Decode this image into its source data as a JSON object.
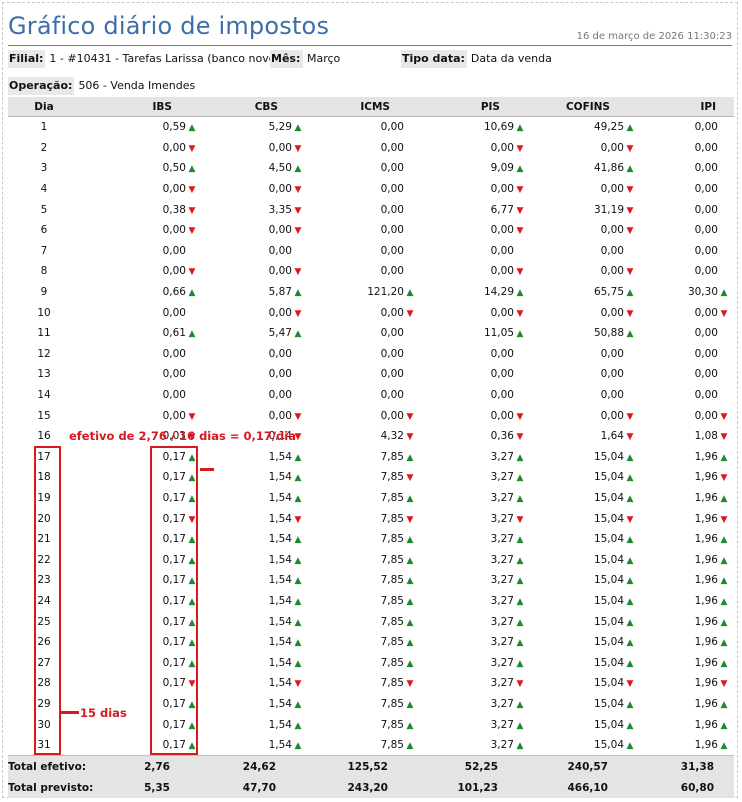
{
  "header": {
    "title": "Gráfico diário de impostos",
    "timestamp": "16 de março de 2026 11:30:23"
  },
  "filters": {
    "filial_label": "Filial:",
    "filial_value": "1 - #10431 - Tarefas Larissa (banco novo)",
    "mes_label": "Mês:",
    "mes_value": "Março",
    "tipo_label": "Tipo data:",
    "tipo_value": "Data da venda",
    "operacao_label": "Operação:",
    "operacao_value": "506 - Venda Imendes"
  },
  "table": {
    "columns": [
      "Dia",
      "IBS",
      "CBS",
      "ICMS",
      "PIS",
      "COFINS",
      "IPI"
    ],
    "rows": [
      [
        "1",
        [
          "0,59",
          "up"
        ],
        [
          "5,29",
          "up"
        ],
        [
          "0,00",
          ""
        ],
        [
          "10,69",
          "up"
        ],
        [
          "49,25",
          "up"
        ],
        [
          "0,00",
          ""
        ]
      ],
      [
        "2",
        [
          "0,00",
          "down"
        ],
        [
          "0,00",
          "down"
        ],
        [
          "0,00",
          ""
        ],
        [
          "0,00",
          "down"
        ],
        [
          "0,00",
          "down"
        ],
        [
          "0,00",
          ""
        ]
      ],
      [
        "3",
        [
          "0,50",
          "up"
        ],
        [
          "4,50",
          "up"
        ],
        [
          "0,00",
          ""
        ],
        [
          "9,09",
          "up"
        ],
        [
          "41,86",
          "up"
        ],
        [
          "0,00",
          ""
        ]
      ],
      [
        "4",
        [
          "0,00",
          "down"
        ],
        [
          "0,00",
          "down"
        ],
        [
          "0,00",
          ""
        ],
        [
          "0,00",
          "down"
        ],
        [
          "0,00",
          "down"
        ],
        [
          "0,00",
          ""
        ]
      ],
      [
        "5",
        [
          "0,38",
          "down"
        ],
        [
          "3,35",
          "down"
        ],
        [
          "0,00",
          ""
        ],
        [
          "6,77",
          "down"
        ],
        [
          "31,19",
          "down"
        ],
        [
          "0,00",
          ""
        ]
      ],
      [
        "6",
        [
          "0,00",
          "down"
        ],
        [
          "0,00",
          "down"
        ],
        [
          "0,00",
          ""
        ],
        [
          "0,00",
          "down"
        ],
        [
          "0,00",
          "down"
        ],
        [
          "0,00",
          ""
        ]
      ],
      [
        "7",
        [
          "0,00",
          ""
        ],
        [
          "0,00",
          ""
        ],
        [
          "0,00",
          ""
        ],
        [
          "0,00",
          ""
        ],
        [
          "0,00",
          ""
        ],
        [
          "0,00",
          ""
        ]
      ],
      [
        "8",
        [
          "0,00",
          "down"
        ],
        [
          "0,00",
          "down"
        ],
        [
          "0,00",
          ""
        ],
        [
          "0,00",
          "down"
        ],
        [
          "0,00",
          "down"
        ],
        [
          "0,00",
          ""
        ]
      ],
      [
        "9",
        [
          "0,66",
          "up"
        ],
        [
          "5,87",
          "up"
        ],
        [
          "121,20",
          "up"
        ],
        [
          "14,29",
          "up"
        ],
        [
          "65,75",
          "up"
        ],
        [
          "30,30",
          "up"
        ]
      ],
      [
        "10",
        [
          "0,00",
          ""
        ],
        [
          "0,00",
          "down"
        ],
        [
          "0,00",
          "down"
        ],
        [
          "0,00",
          "down"
        ],
        [
          "0,00",
          "down"
        ],
        [
          "0,00",
          "down"
        ]
      ],
      [
        "11",
        [
          "0,61",
          "up"
        ],
        [
          "5,47",
          "up"
        ],
        [
          "0,00",
          ""
        ],
        [
          "11,05",
          "up"
        ],
        [
          "50,88",
          "up"
        ],
        [
          "0,00",
          ""
        ]
      ],
      [
        "12",
        [
          "0,00",
          ""
        ],
        [
          "0,00",
          ""
        ],
        [
          "0,00",
          ""
        ],
        [
          "0,00",
          ""
        ],
        [
          "0,00",
          ""
        ],
        [
          "0,00",
          ""
        ]
      ],
      [
        "13",
        [
          "0,00",
          ""
        ],
        [
          "0,00",
          ""
        ],
        [
          "0,00",
          ""
        ],
        [
          "0,00",
          ""
        ],
        [
          "0,00",
          ""
        ],
        [
          "0,00",
          ""
        ]
      ],
      [
        "14",
        [
          "0,00",
          ""
        ],
        [
          "0,00",
          ""
        ],
        [
          "0,00",
          ""
        ],
        [
          "0,00",
          ""
        ],
        [
          "0,00",
          ""
        ],
        [
          "0,00",
          ""
        ]
      ],
      [
        "15",
        [
          "0,00",
          "down"
        ],
        [
          "0,00",
          "down"
        ],
        [
          "0,00",
          "down"
        ],
        [
          "0,00",
          "down"
        ],
        [
          "0,00",
          "down"
        ],
        [
          "0,00",
          "down"
        ]
      ],
      [
        "16",
        [
          "0,03",
          "down"
        ],
        [
          "0,14",
          "down"
        ],
        [
          "4,32",
          "down"
        ],
        [
          "0,36",
          "down"
        ],
        [
          "1,64",
          "down"
        ],
        [
          "1,08",
          "down"
        ]
      ],
      [
        "17",
        [
          "0,17",
          "up"
        ],
        [
          "1,54",
          "up"
        ],
        [
          "7,85",
          "up"
        ],
        [
          "3,27",
          "up"
        ],
        [
          "15,04",
          "up"
        ],
        [
          "1,96",
          "up"
        ]
      ],
      [
        "18",
        [
          "0,17",
          "up"
        ],
        [
          "1,54",
          "up"
        ],
        [
          "7,85",
          "down"
        ],
        [
          "3,27",
          "up"
        ],
        [
          "15,04",
          "up"
        ],
        [
          "1,96",
          "down"
        ]
      ],
      [
        "19",
        [
          "0,17",
          "up"
        ],
        [
          "1,54",
          "up"
        ],
        [
          "7,85",
          "up"
        ],
        [
          "3,27",
          "up"
        ],
        [
          "15,04",
          "up"
        ],
        [
          "1,96",
          "up"
        ]
      ],
      [
        "20",
        [
          "0,17",
          "down"
        ],
        [
          "1,54",
          "down"
        ],
        [
          "7,85",
          "down"
        ],
        [
          "3,27",
          "down"
        ],
        [
          "15,04",
          "down"
        ],
        [
          "1,96",
          "down"
        ]
      ],
      [
        "21",
        [
          "0,17",
          "up"
        ],
        [
          "1,54",
          "up"
        ],
        [
          "7,85",
          "up"
        ],
        [
          "3,27",
          "up"
        ],
        [
          "15,04",
          "up"
        ],
        [
          "1,96",
          "up"
        ]
      ],
      [
        "22",
        [
          "0,17",
          "up"
        ],
        [
          "1,54",
          "up"
        ],
        [
          "7,85",
          "up"
        ],
        [
          "3,27",
          "up"
        ],
        [
          "15,04",
          "up"
        ],
        [
          "1,96",
          "up"
        ]
      ],
      [
        "23",
        [
          "0,17",
          "up"
        ],
        [
          "1,54",
          "up"
        ],
        [
          "7,85",
          "up"
        ],
        [
          "3,27",
          "up"
        ],
        [
          "15,04",
          "up"
        ],
        [
          "1,96",
          "up"
        ]
      ],
      [
        "24",
        [
          "0,17",
          "up"
        ],
        [
          "1,54",
          "up"
        ],
        [
          "7,85",
          "up"
        ],
        [
          "3,27",
          "up"
        ],
        [
          "15,04",
          "up"
        ],
        [
          "1,96",
          "up"
        ]
      ],
      [
        "25",
        [
          "0,17",
          "up"
        ],
        [
          "1,54",
          "up"
        ],
        [
          "7,85",
          "up"
        ],
        [
          "3,27",
          "up"
        ],
        [
          "15,04",
          "up"
        ],
        [
          "1,96",
          "up"
        ]
      ],
      [
        "26",
        [
          "0,17",
          "up"
        ],
        [
          "1,54",
          "up"
        ],
        [
          "7,85",
          "up"
        ],
        [
          "3,27",
          "up"
        ],
        [
          "15,04",
          "up"
        ],
        [
          "1,96",
          "up"
        ]
      ],
      [
        "27",
        [
          "0,17",
          "up"
        ],
        [
          "1,54",
          "up"
        ],
        [
          "7,85",
          "up"
        ],
        [
          "3,27",
          "up"
        ],
        [
          "15,04",
          "up"
        ],
        [
          "1,96",
          "up"
        ]
      ],
      [
        "28",
        [
          "0,17",
          "down"
        ],
        [
          "1,54",
          "down"
        ],
        [
          "7,85",
          "down"
        ],
        [
          "3,27",
          "down"
        ],
        [
          "15,04",
          "down"
        ],
        [
          "1,96",
          "down"
        ]
      ],
      [
        "29",
        [
          "0,17",
          "up"
        ],
        [
          "1,54",
          "up"
        ],
        [
          "7,85",
          "up"
        ],
        [
          "3,27",
          "up"
        ],
        [
          "15,04",
          "up"
        ],
        [
          "1,96",
          "up"
        ]
      ],
      [
        "30",
        [
          "0,17",
          "up"
        ],
        [
          "1,54",
          "up"
        ],
        [
          "7,85",
          "up"
        ],
        [
          "3,27",
          "up"
        ],
        [
          "15,04",
          "up"
        ],
        [
          "1,96",
          "up"
        ]
      ],
      [
        "31",
        [
          "0,17",
          "up"
        ],
        [
          "1,54",
          "up"
        ],
        [
          "7,85",
          "up"
        ],
        [
          "3,27",
          "up"
        ],
        [
          "15,04",
          "up"
        ],
        [
          "1,96",
          "up"
        ]
      ]
    ],
    "totals": [
      {
        "label": "Total efetivo:",
        "values": [
          "2,76",
          "24,62",
          "125,52",
          "52,25",
          "240,57",
          "31,38"
        ]
      },
      {
        "label": "Total previsto:",
        "values": [
          "5,35",
          "47,70",
          "243,20",
          "101,23",
          "466,10",
          "60,80"
        ]
      }
    ]
  },
  "annotations": {
    "efetivo_note": "efetivo de 2,76 / 16 dias = 0,17/dia",
    "days_note": "15 dias"
  },
  "colors": {
    "up_arrow": "#1e8a2a",
    "down_arrow": "#e01818",
    "annotation": "#d71920",
    "title": "#3d6ea8"
  }
}
